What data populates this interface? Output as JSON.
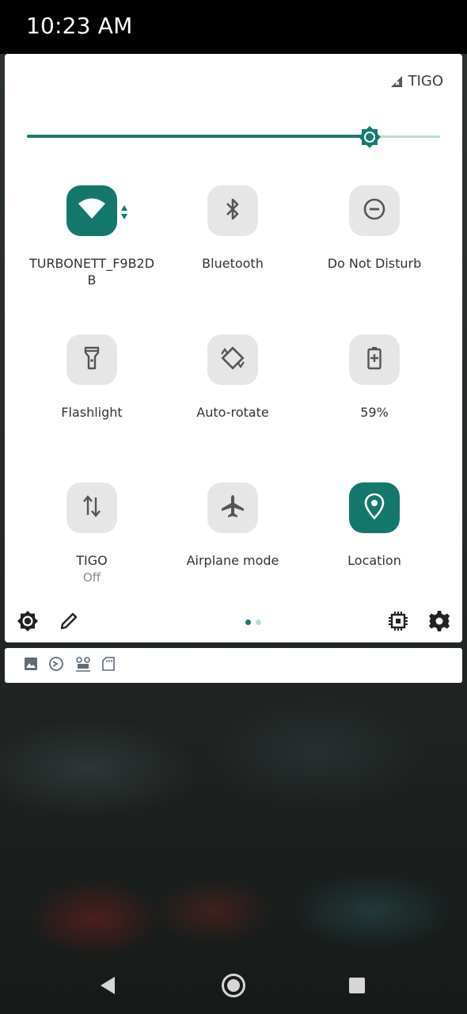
{
  "status_bar": {
    "time": "10:23 AM"
  },
  "quick_settings": {
    "carrier": "TIGO",
    "brightness": 0.83,
    "accent_color": "#13786b",
    "tiles": [
      {
        "id": "wifi",
        "label": "TURBONETT_F9B2DB",
        "active": true,
        "icon": "wifi-icon"
      },
      {
        "id": "bluetooth",
        "label": "Bluetooth",
        "active": false,
        "icon": "bluetooth-icon"
      },
      {
        "id": "dnd",
        "label": "Do Not Disturb",
        "active": false,
        "icon": "do-not-disturb-icon"
      },
      {
        "id": "flashlight",
        "label": "Flashlight",
        "active": false,
        "icon": "flashlight-icon"
      },
      {
        "id": "autorotate",
        "label": "Auto-rotate",
        "active": false,
        "icon": "auto-rotate-icon"
      },
      {
        "id": "battery",
        "label": "59%",
        "active": false,
        "icon": "battery-icon"
      },
      {
        "id": "mobile-data",
        "label": "TIGO",
        "sublabel": "Off",
        "active": false,
        "icon": "mobile-data-icon"
      },
      {
        "id": "airplane",
        "label": "Airplane mode",
        "active": false,
        "icon": "airplane-icon"
      },
      {
        "id": "location",
        "label": "Location",
        "active": true,
        "icon": "location-icon"
      }
    ],
    "page_indicator": {
      "pages": 2,
      "current": 1
    },
    "footer_icons": [
      "brightness-icon",
      "edit-icon",
      "chip-icon",
      "settings-icon"
    ]
  },
  "notification_icons": [
    "gallery-icon",
    "app-icon",
    "group-icon",
    "sd-card-icon"
  ],
  "nav_bar": [
    "back-button",
    "home-button",
    "recents-button"
  ]
}
